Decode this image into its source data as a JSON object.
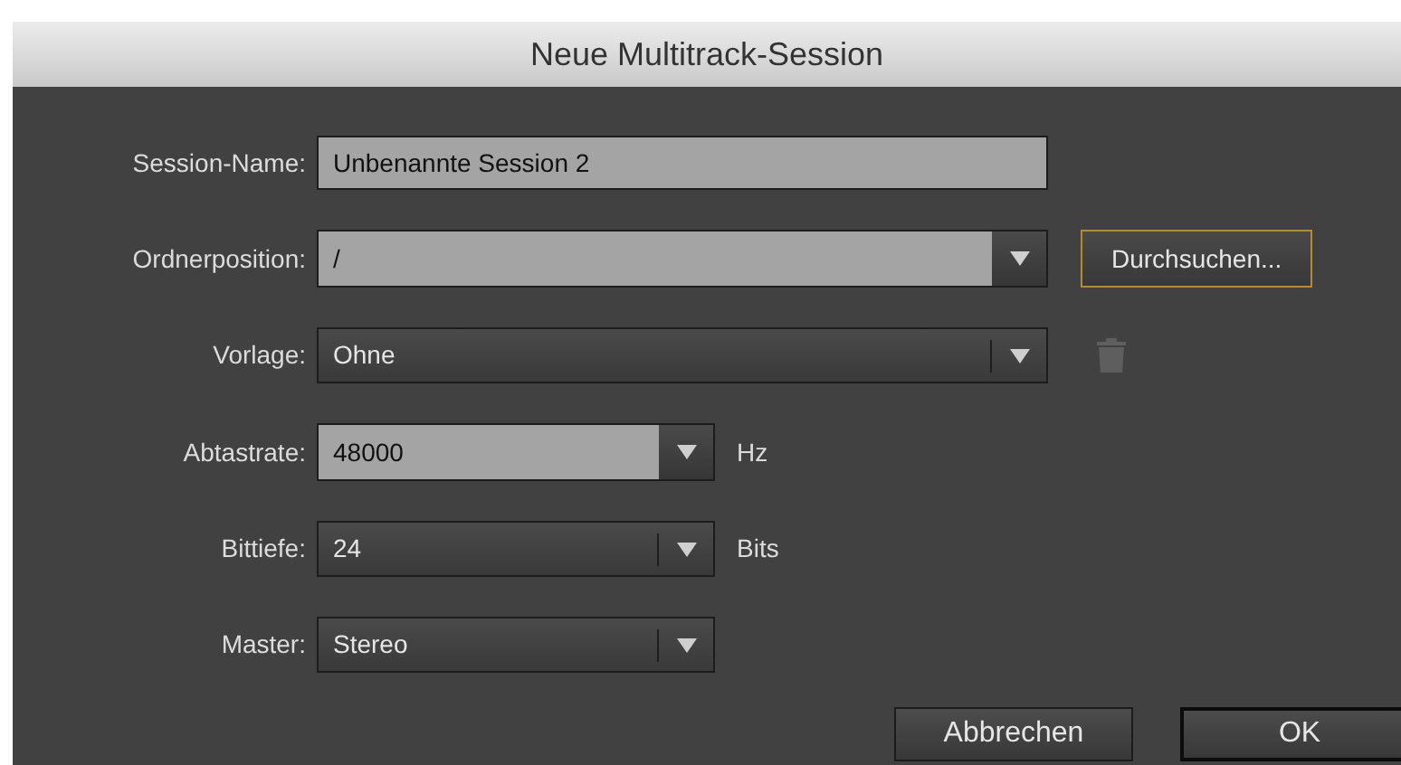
{
  "window": {
    "title": "Neue Multitrack-Session"
  },
  "fields": [
    {
      "label": "Session-Name:",
      "kind": "text",
      "value": "Unbenannte Session 2"
    },
    {
      "label": "Ordnerposition:",
      "kind": "combo",
      "value": "/",
      "button": {
        "label": "Durchsuchen...",
        "focused": true
      }
    },
    {
      "label": "Vorlage:",
      "kind": "dropdown",
      "value": "Ohne",
      "trash": true
    },
    {
      "label": "Abtastrate:",
      "kind": "combo",
      "value": "48000",
      "unit": "Hz"
    },
    {
      "label": "Bittiefe:",
      "kind": "dropdown",
      "value": "24",
      "unit": "Bits"
    },
    {
      "label": "Master:",
      "kind": "dropdown",
      "value": "Stereo"
    }
  ],
  "buttons": [
    {
      "label": "Abbrechen",
      "default": false
    },
    {
      "label": "OK",
      "default": true
    }
  ]
}
